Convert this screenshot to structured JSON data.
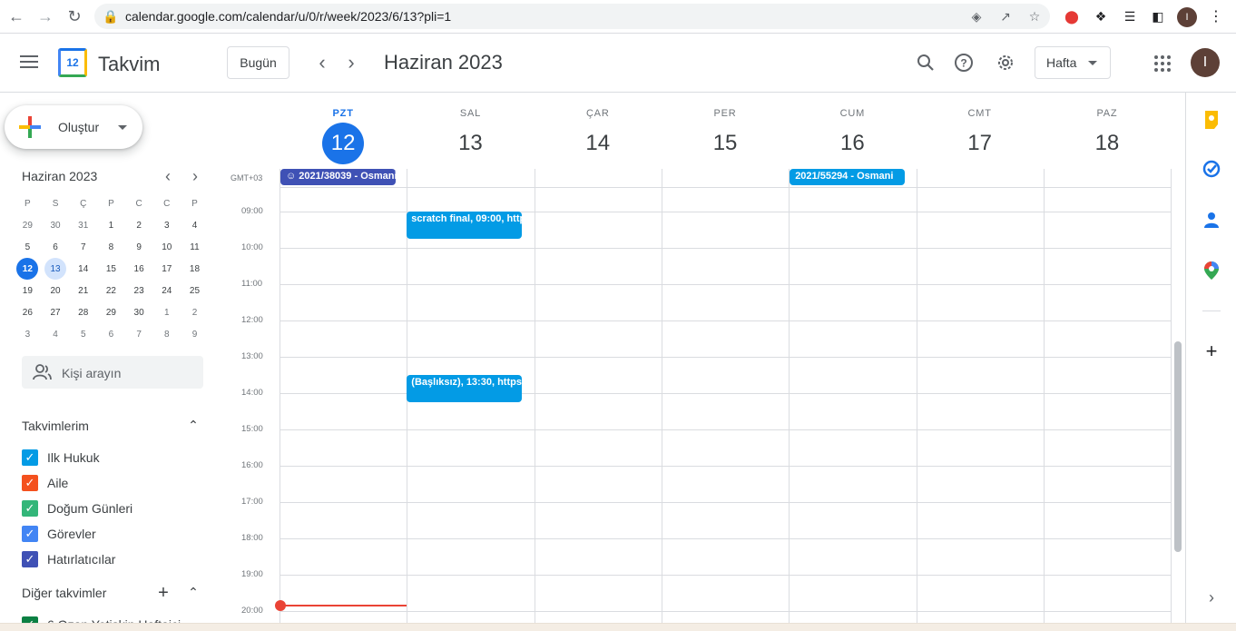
{
  "browser": {
    "url": "calendar.google.com/calendar/u/0/r/week/2023/6/13?pli=1",
    "profile_initial": "I"
  },
  "header": {
    "app_name": "Takvim",
    "logo_day": "12",
    "today_label": "Bugün",
    "period": "Haziran 2023",
    "view": "Hafta",
    "avatar_initial": "I"
  },
  "sidebar": {
    "create_label": "Oluştur",
    "mini_calendar": {
      "title": "Haziran 2023",
      "weekdays": [
        "P",
        "S",
        "Ç",
        "P",
        "C",
        "C",
        "P"
      ],
      "weeks": [
        [
          {
            "d": "29",
            "o": true
          },
          {
            "d": "30",
            "o": true
          },
          {
            "d": "31",
            "o": true
          },
          {
            "d": "1"
          },
          {
            "d": "2"
          },
          {
            "d": "3"
          },
          {
            "d": "4"
          }
        ],
        [
          {
            "d": "5"
          },
          {
            "d": "6"
          },
          {
            "d": "7"
          },
          {
            "d": "8"
          },
          {
            "d": "9"
          },
          {
            "d": "10"
          },
          {
            "d": "11"
          }
        ],
        [
          {
            "d": "12",
            "today": true
          },
          {
            "d": "13",
            "sel": true
          },
          {
            "d": "14"
          },
          {
            "d": "15"
          },
          {
            "d": "16"
          },
          {
            "d": "17"
          },
          {
            "d": "18"
          }
        ],
        [
          {
            "d": "19"
          },
          {
            "d": "20"
          },
          {
            "d": "21"
          },
          {
            "d": "22"
          },
          {
            "d": "23"
          },
          {
            "d": "24"
          },
          {
            "d": "25"
          }
        ],
        [
          {
            "d": "26"
          },
          {
            "d": "27"
          },
          {
            "d": "28"
          },
          {
            "d": "29"
          },
          {
            "d": "30"
          },
          {
            "d": "1",
            "o": true
          },
          {
            "d": "2",
            "o": true
          }
        ],
        [
          {
            "d": "3",
            "o": true
          },
          {
            "d": "4",
            "o": true
          },
          {
            "d": "5",
            "o": true
          },
          {
            "d": "6",
            "o": true
          },
          {
            "d": "7",
            "o": true
          },
          {
            "d": "8",
            "o": true
          },
          {
            "d": "9",
            "o": true
          }
        ]
      ]
    },
    "people_search_placeholder": "Kişi arayın",
    "my_calendars_title": "Takvimlerim",
    "my_calendars": [
      {
        "label": "Ilk Hukuk",
        "color": "#039be5"
      },
      {
        "label": "Aile",
        "color": "#f4511e"
      },
      {
        "label": "Doğum Günleri",
        "color": "#33b679"
      },
      {
        "label": "Görevler",
        "color": "#4285f4"
      },
      {
        "label": "Hatırlatıcılar",
        "color": "#3f51b5"
      }
    ],
    "other_calendars_title": "Diğer takvimler",
    "other_calendar_partial": "6 Ozan Yetişkin Haftaiçi"
  },
  "week": {
    "timezone": "GMT+03",
    "days": [
      {
        "dow": "PZT",
        "num": "12",
        "today": true
      },
      {
        "dow": "SAL",
        "num": "13"
      },
      {
        "dow": "ÇAR",
        "num": "14"
      },
      {
        "dow": "PER",
        "num": "15"
      },
      {
        "dow": "CUM",
        "num": "16"
      },
      {
        "dow": "CMT",
        "num": "17"
      },
      {
        "dow": "PAZ",
        "num": "18"
      }
    ],
    "times": [
      "09:00",
      "10:00",
      "11:00",
      "12:00",
      "13:00",
      "14:00",
      "15:00",
      "16:00",
      "17:00",
      "18:00",
      "19:00",
      "20:00"
    ],
    "allday_events": [
      {
        "title": "2021/38039 - Osmani",
        "day_index": 0,
        "color": "#3f51b5",
        "has_icon": true
      },
      {
        "title": "2021/55294 - Osmani",
        "day_index": 4,
        "color": "#039be5"
      }
    ],
    "events": [
      {
        "title": "scratch final, 09:00, http",
        "day_index": 1,
        "start": "09:00"
      },
      {
        "title": "(Başlıksız), 13:30, https",
        "day_index": 1,
        "start": "13:30"
      }
    ],
    "current_time": "20:00"
  },
  "colors": {
    "accent": "#1a73e8",
    "event": "#039be5",
    "now_line": "#ea4335"
  }
}
